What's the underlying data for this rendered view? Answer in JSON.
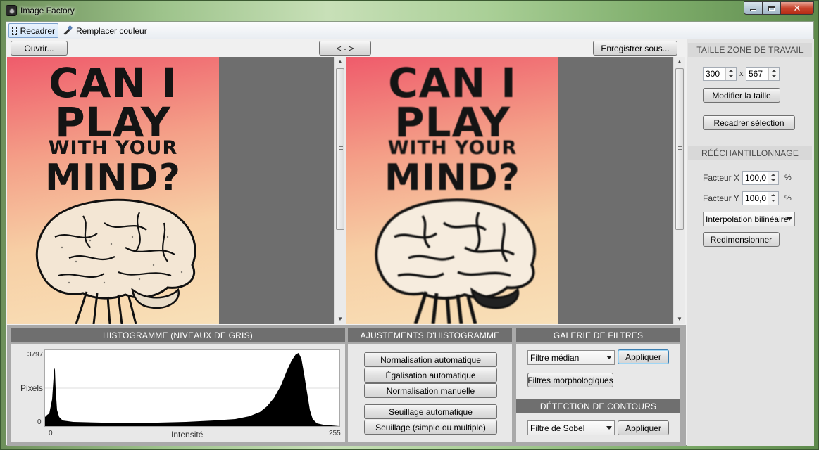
{
  "window": {
    "title": "Image Factory"
  },
  "toolbar": {
    "crop_label": "Recadrer",
    "replace_color_label": "Remplacer couleur"
  },
  "top_buttons": {
    "open": "Ouvrir...",
    "swap": "< - >",
    "save_as": "Enregistrer sous..."
  },
  "posters": {
    "line1": "CAN I",
    "line2": "PLAY",
    "line3": "WITH YOUR",
    "line4": "MIND?"
  },
  "histogram": {
    "header": "HISTOGRAMME  (NIVEAUX DE GRIS)",
    "y_max": "3797",
    "y_min": "0",
    "y_label": "Pixels",
    "x_min": "0",
    "x_max": "255",
    "x_label": "Intensité"
  },
  "adjustments": {
    "header": "AJUSTEMENTS D'HISTOGRAMME",
    "auto_normalization": "Normalisation automatique",
    "auto_equalization": "Égalisation automatique",
    "manual_normalization": "Normalisation manuelle",
    "auto_threshold": "Seuillage automatique",
    "threshold_simple_multiple": "Seuillage (simple ou multiple)"
  },
  "filters": {
    "header": "GALERIE DE FILTRES",
    "selected_filter": "Filtre médian",
    "apply": "Appliquer",
    "morphological": "Filtres morphologiques"
  },
  "edges": {
    "header": "DÉTECTION DE CONTOURS",
    "selected_filter": "Filtre de Sobel",
    "apply": "Appliquer"
  },
  "workspace": {
    "header": "TAILLE ZONE DE TRAVAIL",
    "width": "300",
    "times": "x",
    "height": "567",
    "resize_button": "Modifier la taille",
    "crop_selection_button": "Recadrer sélection"
  },
  "resampling": {
    "header": "RÉÉCHANTILLONNAGE",
    "factor_x_label": "Facteur X",
    "factor_x_value": "100,0",
    "factor_x_unit": "%",
    "factor_y_label": "Facteur Y",
    "factor_y_value": "100,0",
    "factor_y_unit": "%",
    "interpolation": "Interpolation bilinéaire",
    "resize_button": "Redimensionner"
  },
  "colors": {
    "poster_top": "#ef5b6b",
    "poster_bottom": "#f7d8a8",
    "panel_gray": "#6e6e6e",
    "header_gray": "#6f6f6f"
  }
}
